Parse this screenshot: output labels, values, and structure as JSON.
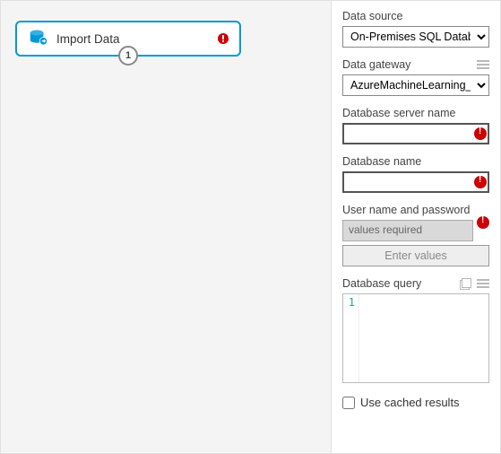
{
  "module": {
    "title": "Import Data",
    "port_number": "1",
    "has_error": true
  },
  "panel": {
    "data_source": {
      "label": "Data source",
      "value": "On-Premises SQL Database"
    },
    "data_gateway": {
      "label": "Data gateway",
      "value": "AzureMachineLearning_On"
    },
    "db_server": {
      "label": "Database server name",
      "value": ""
    },
    "db_name": {
      "label": "Database name",
      "value": ""
    },
    "credentials": {
      "label": "User name and password",
      "status": "values required",
      "button": "Enter values"
    },
    "query": {
      "label": "Database query",
      "line_number": "1",
      "content": ""
    },
    "cache": {
      "label": "Use cached results",
      "checked": false
    }
  }
}
